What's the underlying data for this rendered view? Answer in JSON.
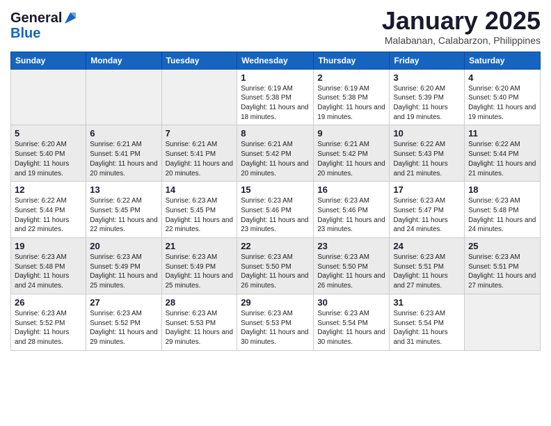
{
  "header": {
    "logo_general": "General",
    "logo_blue": "Blue",
    "month_title": "January 2025",
    "location": "Malabanan, Calabarzon, Philippines"
  },
  "days_of_week": [
    "Sunday",
    "Monday",
    "Tuesday",
    "Wednesday",
    "Thursday",
    "Friday",
    "Saturday"
  ],
  "weeks": [
    [
      {
        "num": "",
        "info": ""
      },
      {
        "num": "",
        "info": ""
      },
      {
        "num": "",
        "info": ""
      },
      {
        "num": "1",
        "info": "Sunrise: 6:19 AM\nSunset: 5:38 PM\nDaylight: 11 hours and 18 minutes."
      },
      {
        "num": "2",
        "info": "Sunrise: 6:19 AM\nSunset: 5:38 PM\nDaylight: 11 hours and 19 minutes."
      },
      {
        "num": "3",
        "info": "Sunrise: 6:20 AM\nSunset: 5:39 PM\nDaylight: 11 hours and 19 minutes."
      },
      {
        "num": "4",
        "info": "Sunrise: 6:20 AM\nSunset: 5:40 PM\nDaylight: 11 hours and 19 minutes."
      }
    ],
    [
      {
        "num": "5",
        "info": "Sunrise: 6:20 AM\nSunset: 5:40 PM\nDaylight: 11 hours and 19 minutes."
      },
      {
        "num": "6",
        "info": "Sunrise: 6:21 AM\nSunset: 5:41 PM\nDaylight: 11 hours and 20 minutes."
      },
      {
        "num": "7",
        "info": "Sunrise: 6:21 AM\nSunset: 5:41 PM\nDaylight: 11 hours and 20 minutes."
      },
      {
        "num": "8",
        "info": "Sunrise: 6:21 AM\nSunset: 5:42 PM\nDaylight: 11 hours and 20 minutes."
      },
      {
        "num": "9",
        "info": "Sunrise: 6:21 AM\nSunset: 5:42 PM\nDaylight: 11 hours and 20 minutes."
      },
      {
        "num": "10",
        "info": "Sunrise: 6:22 AM\nSunset: 5:43 PM\nDaylight: 11 hours and 21 minutes."
      },
      {
        "num": "11",
        "info": "Sunrise: 6:22 AM\nSunset: 5:44 PM\nDaylight: 11 hours and 21 minutes."
      }
    ],
    [
      {
        "num": "12",
        "info": "Sunrise: 6:22 AM\nSunset: 5:44 PM\nDaylight: 11 hours and 22 minutes."
      },
      {
        "num": "13",
        "info": "Sunrise: 6:22 AM\nSunset: 5:45 PM\nDaylight: 11 hours and 22 minutes."
      },
      {
        "num": "14",
        "info": "Sunrise: 6:23 AM\nSunset: 5:45 PM\nDaylight: 11 hours and 22 minutes."
      },
      {
        "num": "15",
        "info": "Sunrise: 6:23 AM\nSunset: 5:46 PM\nDaylight: 11 hours and 23 minutes."
      },
      {
        "num": "16",
        "info": "Sunrise: 6:23 AM\nSunset: 5:46 PM\nDaylight: 11 hours and 23 minutes."
      },
      {
        "num": "17",
        "info": "Sunrise: 6:23 AM\nSunset: 5:47 PM\nDaylight: 11 hours and 24 minutes."
      },
      {
        "num": "18",
        "info": "Sunrise: 6:23 AM\nSunset: 5:48 PM\nDaylight: 11 hours and 24 minutes."
      }
    ],
    [
      {
        "num": "19",
        "info": "Sunrise: 6:23 AM\nSunset: 5:48 PM\nDaylight: 11 hours and 24 minutes."
      },
      {
        "num": "20",
        "info": "Sunrise: 6:23 AM\nSunset: 5:49 PM\nDaylight: 11 hours and 25 minutes."
      },
      {
        "num": "21",
        "info": "Sunrise: 6:23 AM\nSunset: 5:49 PM\nDaylight: 11 hours and 25 minutes."
      },
      {
        "num": "22",
        "info": "Sunrise: 6:23 AM\nSunset: 5:50 PM\nDaylight: 11 hours and 26 minutes."
      },
      {
        "num": "23",
        "info": "Sunrise: 6:23 AM\nSunset: 5:50 PM\nDaylight: 11 hours and 26 minutes."
      },
      {
        "num": "24",
        "info": "Sunrise: 6:23 AM\nSunset: 5:51 PM\nDaylight: 11 hours and 27 minutes."
      },
      {
        "num": "25",
        "info": "Sunrise: 6:23 AM\nSunset: 5:51 PM\nDaylight: 11 hours and 27 minutes."
      }
    ],
    [
      {
        "num": "26",
        "info": "Sunrise: 6:23 AM\nSunset: 5:52 PM\nDaylight: 11 hours and 28 minutes."
      },
      {
        "num": "27",
        "info": "Sunrise: 6:23 AM\nSunset: 5:52 PM\nDaylight: 11 hours and 29 minutes."
      },
      {
        "num": "28",
        "info": "Sunrise: 6:23 AM\nSunset: 5:53 PM\nDaylight: 11 hours and 29 minutes."
      },
      {
        "num": "29",
        "info": "Sunrise: 6:23 AM\nSunset: 5:53 PM\nDaylight: 11 hours and 30 minutes."
      },
      {
        "num": "30",
        "info": "Sunrise: 6:23 AM\nSunset: 5:54 PM\nDaylight: 11 hours and 30 minutes."
      },
      {
        "num": "31",
        "info": "Sunrise: 6:23 AM\nSunset: 5:54 PM\nDaylight: 11 hours and 31 minutes."
      },
      {
        "num": "",
        "info": ""
      }
    ]
  ]
}
